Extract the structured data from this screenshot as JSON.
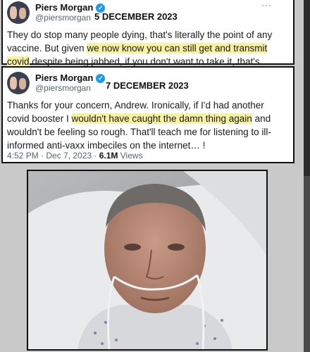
{
  "tweet1": {
    "author": "Piers Morgan",
    "handle": "@piersmorgan",
    "date": "5 DECEMBER 2023",
    "more": "···",
    "text_a": "They do stop many people dying, that's literally the point of any vaccine. But given ",
    "highlight": "we now know you can still get and transmit covid",
    "text_b": " despite being jabbed, if you don't want to take it, that's entirely your choice."
  },
  "tweet2": {
    "author": "Piers Morgan",
    "handle": "@piersmorgan",
    "date": "7 DECEMBER 2023",
    "text_a": "Thanks for your concern, Andrew. Ironically, if I'd had another covid booster I ",
    "highlight": "wouldn't have caught the damn thing again",
    "text_b": " and wouldn't be feeling so rough. That'll teach me for listening to ill-informed anti-vaxx imbeciles on the internet… !",
    "time": "4:52 PM · Dec 7, 2023 · ",
    "views_count": "6.1M",
    "views_label": " Views"
  },
  "icons": {
    "verified": "verified-badge-icon"
  },
  "colors": {
    "highlight": "#f7f2a0",
    "verified": "#1d9bf0"
  }
}
